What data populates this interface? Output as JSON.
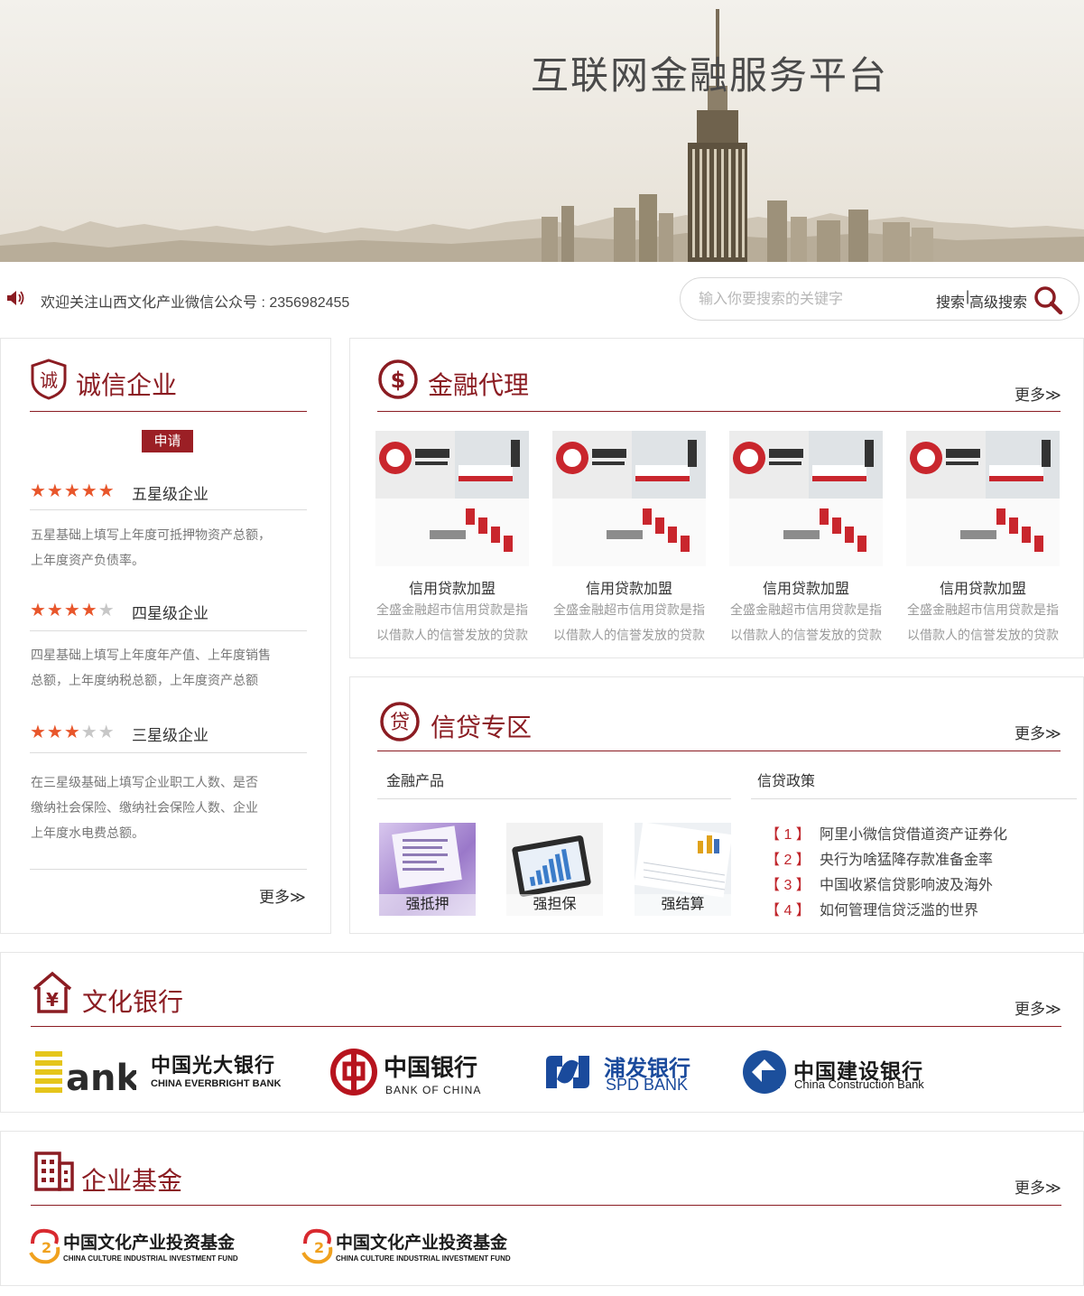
{
  "banner": {
    "title": "互联网金融服务平台"
  },
  "notice": {
    "icon": "speaker-icon",
    "text": "欢迎关注山西文化产业微信公众号 : 2356982455"
  },
  "search": {
    "placeholder": "输入你要搜索的关键字",
    "search_label": "搜索",
    "separator": "|",
    "advanced_label": "高级搜索",
    "icon": "search-icon"
  },
  "integrity": {
    "title": "诚信企业",
    "icon_text": "诚",
    "apply_label": "申请",
    "levels": [
      {
        "stars": 5,
        "label": "五星级企业",
        "desc": "五星基础上填写上年度可抵押物资产总额，上年度资产负债率。"
      },
      {
        "stars": 4,
        "label": "四星级企业",
        "desc": "四星基础上填写上年度年产值、上年度销售总额，上年度纳税总额，上年度资产总额"
      },
      {
        "stars": 3,
        "label": "三星级企业",
        "desc": "在三星级基础上填写企业职工人数、是否缴纳社会保险、缴纳社会保险人数、企业上年度水电费总额。"
      }
    ],
    "more_label": "更多≫"
  },
  "finance_proxy": {
    "title": "金融代理",
    "more_label": "更多≫",
    "cards": [
      {
        "title": "信用贷款加盟",
        "desc_line1": "全盛金融超市信用贷款是指",
        "desc_line2": "以借款人的信誉发放的贷款"
      },
      {
        "title": "信用贷款加盟",
        "desc_line1": "全盛金融超市信用贷款是指",
        "desc_line2": "以借款人的信誉发放的贷款"
      },
      {
        "title": "信用贷款加盟",
        "desc_line1": "全盛金融超市信用贷款是指",
        "desc_line2": "以借款人的信誉发放的贷款"
      },
      {
        "title": "信用贷款加盟",
        "desc_line1": "全盛金融超市信用贷款是指",
        "desc_line2": "以借款人的信誉发放的贷款"
      }
    ]
  },
  "credit_zone": {
    "title": "信贷专区",
    "icon_text": "贷",
    "more_label": "更多≫",
    "products_heading": "金融产品",
    "policy_heading": "信贷政策",
    "products": [
      {
        "label": "强抵押"
      },
      {
        "label": "强担保"
      },
      {
        "label": "强结算"
      }
    ],
    "policies": [
      {
        "num": "【 1 】",
        "text": "阿里小微信贷借道资产证券化"
      },
      {
        "num": "【 2 】",
        "text": "央行为啥猛降存款准备金率"
      },
      {
        "num": "【 3 】",
        "text": "中国收紧信贷影响波及海外"
      },
      {
        "num": "【 4 】",
        "text": "如何管理信贷泛滥的世界"
      }
    ]
  },
  "culture_bank": {
    "title": "文化银行",
    "more_label": "更多≫",
    "banks": [
      {
        "cn": "中国光大银行",
        "en": "CHINA EVERBRIGHT BANK",
        "mark": "Bank"
      },
      {
        "cn": "中国银行",
        "en": "BANK OF CHINA"
      },
      {
        "cn": "浦发银行",
        "en": "SPD BANK"
      },
      {
        "cn": "中国建设银行",
        "en": "China Construction Bank"
      }
    ]
  },
  "enterprise_fund": {
    "title": "企业基金",
    "more_label": "更多≫",
    "funds": [
      {
        "cn": "中国文化产业投资基金",
        "en": "CHINA CULTURE INDUSTRIAL INVESTMENT FUND"
      },
      {
        "cn": "中国文化产业投资基金",
        "en": "CHINA CULTURE INDUSTRIAL INVESTMENT FUND"
      }
    ]
  },
  "colors": {
    "accent": "#8b1c22",
    "star": "#e8562b",
    "policy_num": "#c0262c"
  }
}
